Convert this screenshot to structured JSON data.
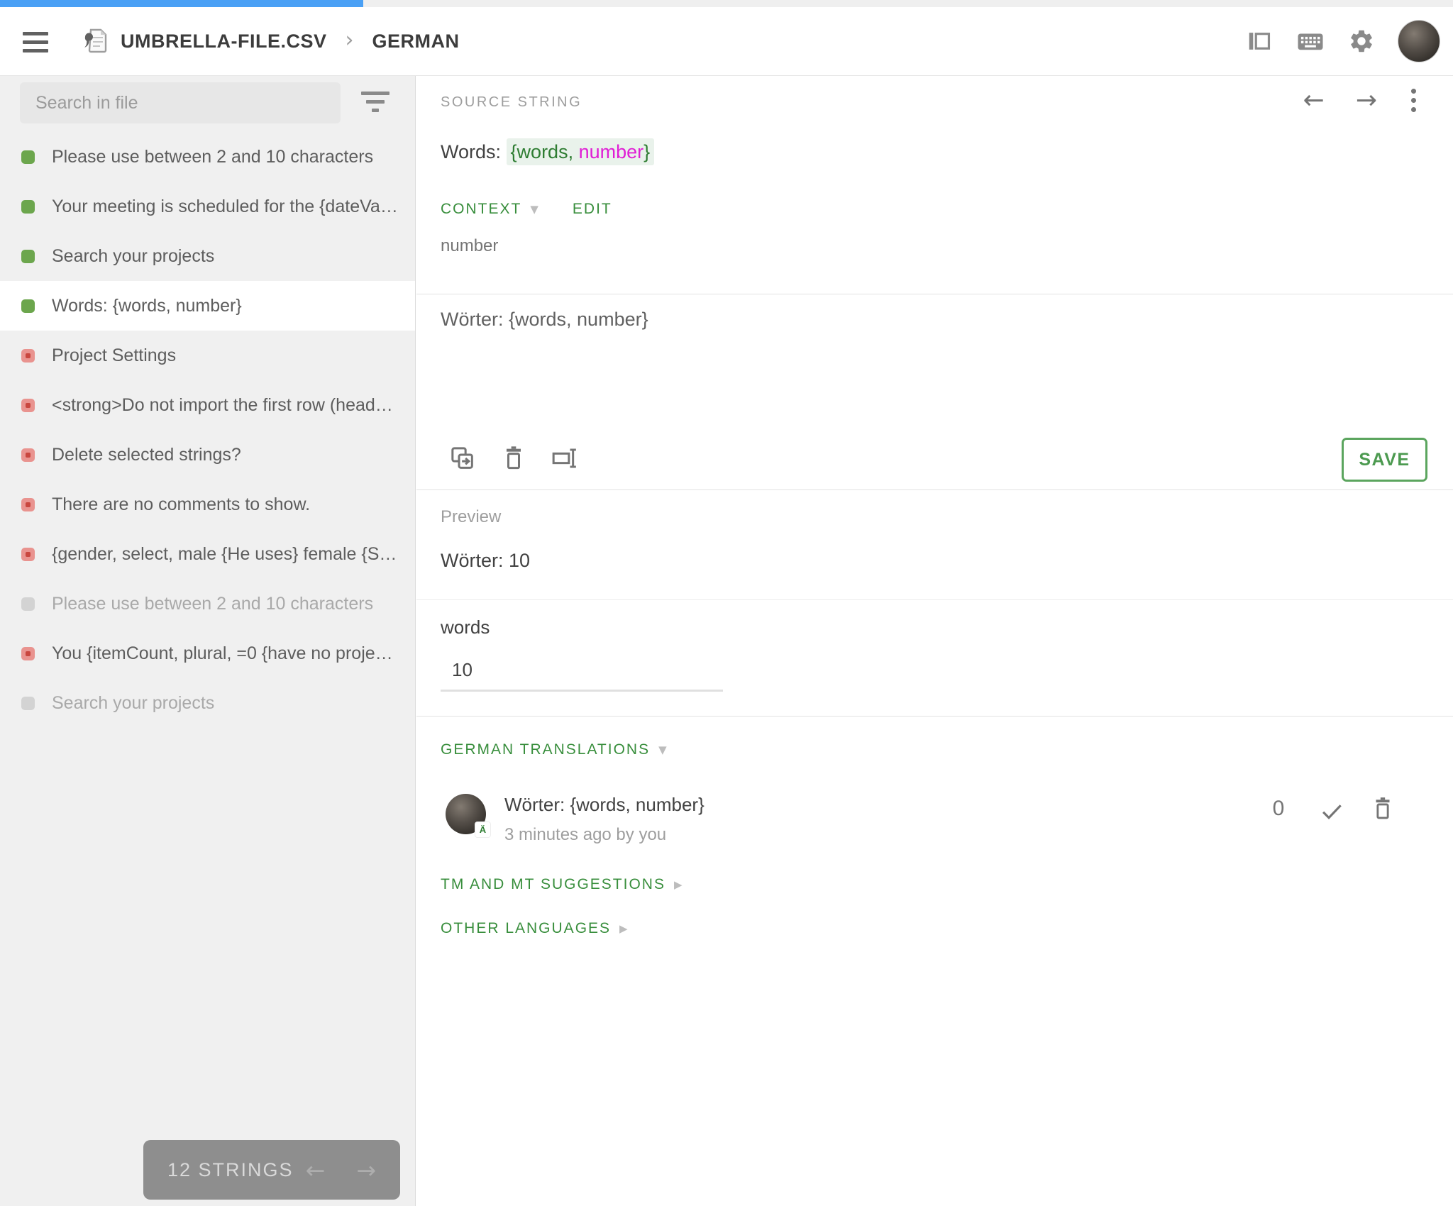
{
  "progress": {
    "percent": 25
  },
  "header": {
    "file_name": "UMBRELLA-FILE.CSV",
    "language": "GERMAN",
    "icons": [
      "menu-icon",
      "csv-file-icon",
      "breadcrumb-chevron-icon",
      "panel-toggle-icon",
      "keyboard-icon",
      "settings-gear-icon",
      "user-avatar"
    ]
  },
  "sidebar": {
    "search_placeholder": "Search in file",
    "items": [
      {
        "label": "Please use between 2 and 10 characters",
        "status": "translated",
        "selected": false
      },
      {
        "label": "Your meeting is scheduled for the {dateVal…",
        "status": "translated",
        "selected": false
      },
      {
        "label": "Search your projects",
        "status": "translated",
        "selected": false
      },
      {
        "label": "Words: {words, number}",
        "status": "translated",
        "selected": true
      },
      {
        "label": "Project Settings",
        "status": "untranslated",
        "selected": false
      },
      {
        "label": "<strong>Do not import the first row (heade…",
        "status": "untranslated",
        "selected": false
      },
      {
        "label": "Delete selected strings?",
        "status": "untranslated",
        "selected": false
      },
      {
        "label": "There are no comments to show.",
        "status": "untranslated",
        "selected": false
      },
      {
        "label": "{gender, select, male {He uses} female {Sh…",
        "status": "untranslated",
        "selected": false
      },
      {
        "label": "Please use between 2 and 10 characters",
        "status": "inactive",
        "selected": false
      },
      {
        "label": "You {itemCount, plural, =0 {have no project…",
        "status": "untranslated",
        "selected": false
      },
      {
        "label": "Search your projects",
        "status": "inactive",
        "selected": false
      }
    ],
    "footer": {
      "count_label": "12 STRINGS",
      "prev_icon": "←",
      "next_icon": "→"
    }
  },
  "main": {
    "source_label": "SOURCE STRING",
    "source": {
      "prefix": "Words: ",
      "token_open": "{words,",
      "token_arg": " number",
      "token_close": "}"
    },
    "context": {
      "label": "CONTEXT",
      "edit_label": "EDIT",
      "value": "number"
    },
    "editor": {
      "value": "Wörter: {words, number}",
      "tools": [
        "copy-source-icon",
        "delete-translation-icon",
        "insert-placeholder-icon"
      ],
      "save_label": "SAVE"
    },
    "preview": {
      "label": "Preview",
      "rendered": "Wörter: 10",
      "param_label": "words",
      "param_value": "10"
    },
    "translations": {
      "title": "GERMAN TRANSLATIONS",
      "entries": [
        {
          "text": "Wörter: {words, number}",
          "meta": "3 minutes ago by you",
          "votes": "0"
        }
      ]
    },
    "tm_suggestions_label": "TM AND MT SUGGESTIONS",
    "other_languages_label": "OTHER LANGUAGES"
  },
  "colors": {
    "progress_blue": "#4aa0f5",
    "accent_green": "#388e3c",
    "save_green": "#5ba55e",
    "placeholder_green": "#2e7d32",
    "placeholder_magenta": "#e01fd5",
    "highlight_bg": "#e9f2eb",
    "status_translated": "#6ca64d",
    "status_untranslated": "#e9938f",
    "status_inactive": "#d3d3d3",
    "sidebar_bg": "#f0f0f0"
  }
}
